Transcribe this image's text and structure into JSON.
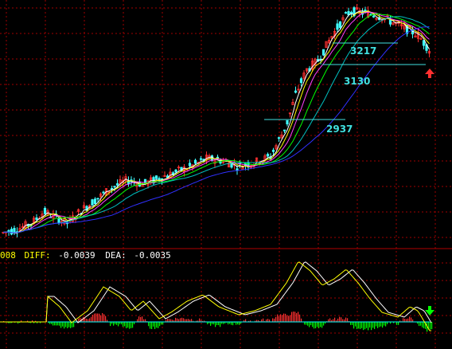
{
  "chart_data": [
    {
      "type": "line",
      "title": "",
      "panel": "price",
      "ylim": [
        2700,
        3320
      ],
      "price_levels": [
        {
          "label": "3217",
          "value": 3217
        },
        {
          "label": "3130",
          "value": 3130
        },
        {
          "label": "2937",
          "value": 2937
        }
      ],
      "ma_colors": [
        "#ffffff",
        "#ffff00",
        "#ff40ff",
        "#00ff00",
        "#00c0c0",
        "#3030ff"
      ],
      "up_color": "#ff3030",
      "down_color": "#40ffff",
      "grid": true,
      "signal": {
        "direction": "up",
        "color": "#ff3030"
      }
    },
    {
      "type": "line",
      "panel": "macd",
      "legend": {
        "prefix": "008",
        "diff_label": "DIFF:",
        "diff_value": "-0.0039",
        "dea_label": "DEA:",
        "dea_value": "-0.0035"
      },
      "diff_color": "#ffff00",
      "dea_color": "#ffffff",
      "bar_pos_color": "#ff3030",
      "bar_neg_color": "#00ff00",
      "zero_line_color": "#00ffff",
      "grid": true,
      "signal": {
        "direction": "down",
        "color": "#00ff00"
      }
    }
  ]
}
